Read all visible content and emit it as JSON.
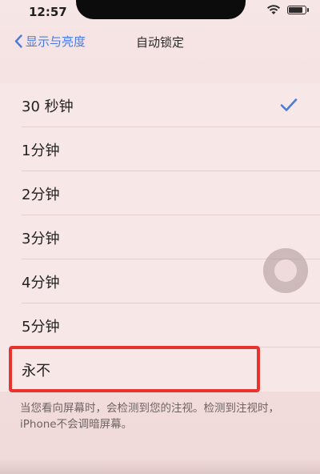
{
  "status_bar": {
    "time": "12:57",
    "icons": [
      "wifi-icon",
      "battery-icon"
    ]
  },
  "nav": {
    "back_label": "显示与亮度",
    "title": "自动锁定"
  },
  "options": [
    {
      "label": "30 秒钟",
      "selected": true
    },
    {
      "label": "1分钟",
      "selected": false
    },
    {
      "label": "2分钟",
      "selected": false
    },
    {
      "label": "3分钟",
      "selected": false
    },
    {
      "label": "4分钟",
      "selected": false
    },
    {
      "label": "5分钟",
      "selected": false
    },
    {
      "label": "永不",
      "selected": false
    }
  ],
  "footer_note": "当您看向屏幕时，会检测到您的注视。检测到注视时，iPhone不会调暗屏幕。",
  "colors": {
    "accent": "#4a7be0",
    "highlight": "#e8322e"
  }
}
